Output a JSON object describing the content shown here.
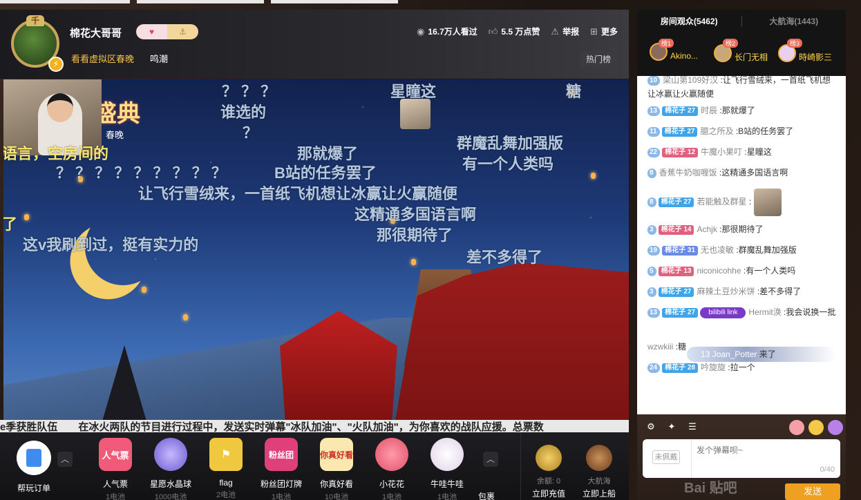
{
  "header": {
    "streamer_name": "棉花大哥哥",
    "avatar_badge": "千",
    "area": "看看虚拟区春晚",
    "area_sub": "鸣潮",
    "views": "16.7万人看过",
    "likes": "5.5 万点赞",
    "report": "举报",
    "more": "更多",
    "hot_rank": "热门榜",
    "follow_icon_a": "♥",
    "follow_icon_b": "⚓"
  },
  "video": {
    "logo": "盛典",
    "logo_sub": "春晚",
    "danmaku": [
      "？ ？ ？",
      "星瞳这",
      "糖",
      "谁选的",
      "？",
      "语言，空房间的",
      "群魔乱舞加强版",
      "那就爆了",
      "有一个人类吗",
      "B站的任务罢了",
      "？ ？ ？ ？ ？ ？ ？ ？ ？",
      "让飞行雪绒来，一首纸飞机想让冰赢让火赢随便",
      "这精通多国语言啊",
      "那很期待了",
      "这v我刷到过，挺有实力的",
      "差不多得了",
      "了"
    ],
    "ticker": "e季获胜队伍　　在冰火两队的节目进行过程中，发送实时弹幕\"冰队加油\"、\"火队加油\"，为你喜欢的战队应援。总票数"
  },
  "giftbar": {
    "help": "帮玩订单",
    "gifts": [
      {
        "name": "人气票",
        "price": "1电池",
        "label": "人气票",
        "color": "#f25a7a"
      },
      {
        "name": "星愿水晶球",
        "price": "1000电池",
        "label": "",
        "color": "#8a7ae0"
      },
      {
        "name": "flag",
        "price": "2电池",
        "label": "",
        "color": "#2a2a2e"
      },
      {
        "name": "粉丝团灯牌",
        "price": "1电池",
        "label": "粉丝团",
        "color": "#e0407a"
      },
      {
        "name": "你真好看",
        "price": "10电池",
        "label": "你真好看",
        "color": "#2a2a2e"
      },
      {
        "name": "小花花",
        "price": "1电池",
        "label": "",
        "color": "#f07a8a"
      },
      {
        "name": "牛哇牛哇",
        "price": "1电池",
        "label": "",
        "color": "#e88aa0"
      }
    ],
    "pack": "包裹",
    "balance_label": "余额: 0",
    "recharge": "立即充值",
    "fleet_label": "大航海",
    "board": "立即上船"
  },
  "side": {
    "tab_audience": "房间观众(5462)",
    "tab_fleet": "大航海(1443)",
    "top3": [
      {
        "rank": "榜1",
        "name": "Akino..."
      },
      {
        "rank": "榜2",
        "name": "长门无相"
      },
      {
        "rank": "榜3",
        "name": "時崎影三"
      }
    ],
    "chat": [
      {
        "lv": "10",
        "fan": "",
        "user": "梁山第109好汉",
        "text": "让飞行雪绒来，一首纸飞机想让冰赢让火赢随便"
      },
      {
        "lv": "13",
        "fan": "棉花子 27",
        "user": "时辰",
        "text": "那就爆了"
      },
      {
        "lv": "11",
        "fan": "棉花子 27",
        "user": "臆之所及",
        "text": "B站的任务罢了"
      },
      {
        "lv": "22",
        "fan": "棉花子 12",
        "user": "牛魔小果叮",
        "text": "星瞳这"
      },
      {
        "lv": "8",
        "fan": "",
        "user": "香蕉牛奶咖喱饭",
        "text": "这精通多国语言啊"
      },
      {
        "lv": "8",
        "fan": "棉花子 27",
        "user": "若能触及群星",
        "text": ""
      },
      {
        "lv": "3",
        "fan": "棉花子 14",
        "user": "Achjk",
        "text": "那很期待了"
      },
      {
        "lv": "19",
        "fan": "棉花子 31",
        "user": "无也凌敏",
        "text": "群魔乱舞加强版"
      },
      {
        "lv": "5",
        "fan": "棉花子 13",
        "user": "niconicohhe",
        "text": "有一个人类吗"
      },
      {
        "lv": "3",
        "fan": "棉花子 27",
        "user": "麻辣土豆炒米饼",
        "text": "差不多得了"
      },
      {
        "lv": "13",
        "fan": "棉花子 27",
        "user": "Hermit涣",
        "text": "我会说换一批"
      },
      {
        "lv": "",
        "fan": "",
        "user": "wzwkiii",
        "text": "糖"
      },
      {
        "lv": "24",
        "fan": "棉花子 28",
        "user": "吟旋旋",
        "text": "拉一个"
      }
    ],
    "bili_tag": "bilibili link",
    "entry_lv": "13",
    "entry_user": "Joan_Potter",
    "entry_text": "来了",
    "medal": "未佩戴",
    "input_placeholder": "发个弹幕呗~",
    "counter": "0/40",
    "send": "发送",
    "watermark": "Bai 贴吧"
  }
}
